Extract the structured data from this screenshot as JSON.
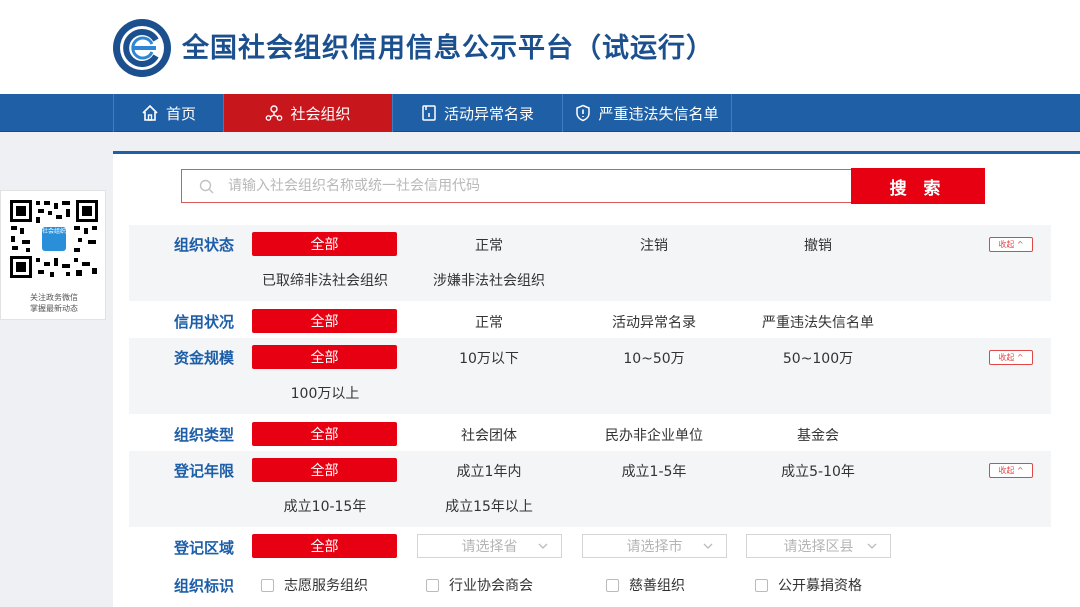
{
  "site": {
    "title": "全国社会组织信用信息公示平台（试运行）"
  },
  "nav": {
    "items": [
      {
        "label": "首页",
        "icon": "home-icon"
      },
      {
        "label": "社会组织",
        "icon": "org-icon",
        "active": true
      },
      {
        "label": "活动异常名录",
        "icon": "document-icon"
      },
      {
        "label": "严重违法失信名单",
        "icon": "shield-icon"
      }
    ]
  },
  "qr": {
    "badge": "社会组织",
    "line1": "关注政务微信",
    "line2": "掌握最新动态"
  },
  "search": {
    "placeholder": "请输入社会组织名称或统一社会信用代码",
    "button": "搜 索"
  },
  "filters": {
    "collapse_label": "收起 ^",
    "status": {
      "label": "组织状态",
      "all": "全部",
      "options": [
        "正常",
        "注销",
        "撤销",
        "已取缔非法社会组织",
        "涉嫌非法社会组织"
      ]
    },
    "credit": {
      "label": "信用状况",
      "all": "全部",
      "options": [
        "正常",
        "活动异常名录",
        "严重违法失信名单"
      ]
    },
    "capital": {
      "label": "资金规模",
      "all": "全部",
      "options": [
        "10万以下",
        "10~50万",
        "50~100万",
        "100万以上"
      ]
    },
    "type": {
      "label": "组织类型",
      "all": "全部",
      "options": [
        "社会团体",
        "民办非企业单位",
        "基金会"
      ]
    },
    "years": {
      "label": "登记年限",
      "all": "全部",
      "options": [
        "成立1年内",
        "成立1-5年",
        "成立5-10年",
        "成立10-15年",
        "成立15年以上"
      ]
    },
    "region": {
      "label": "登记区域",
      "all": "全部",
      "province_placeholder": "请选择省",
      "city_placeholder": "请选择市",
      "district_placeholder": "请选择区县"
    },
    "tags": {
      "label": "组织标识",
      "options": [
        "志愿服务组织",
        "行业协会商会",
        "慈善组织",
        "公开募捐资格"
      ]
    }
  }
}
